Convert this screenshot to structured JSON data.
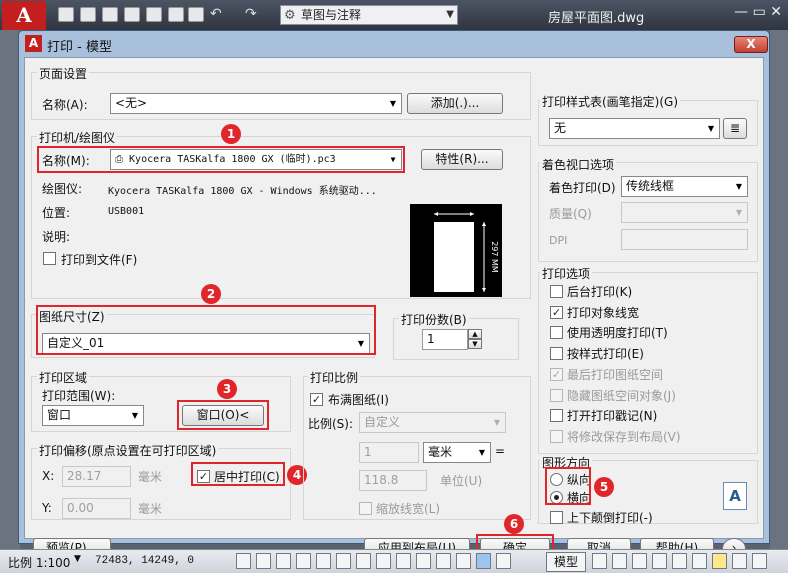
{
  "app": {
    "workspace": "草图与注释",
    "filename": "房屋平面图.dwg",
    "win_controls": "—   ▭   ✕"
  },
  "dialog": {
    "title": "打印 - 模型",
    "close": "X",
    "page_setup": {
      "group": "页面设置",
      "name_label": "名称(A):",
      "name_value": "<无>",
      "add_button": "添加(.)..."
    },
    "printer": {
      "group": "打印机/绘图仪",
      "name_label": "名称(M):",
      "name_value": "Kyocera TASKalfa 1800 GX (临时).pc3",
      "props_button": "特性(R)...",
      "plotter_label": "绘图仪:",
      "plotter_value": "Kyocera TASKalfa 1800 GX - Windows 系统驱动...",
      "location_label": "位置:",
      "location_value": "USB001",
      "desc_label": "说明:",
      "print_to_file": "打印到文件(F)",
      "preview_dim_top": "210 MM",
      "preview_dim_side": "297 MM"
    },
    "paper": {
      "group": "图纸尺寸(Z)",
      "value": "自定义_01"
    },
    "copies": {
      "group": "打印份数(B)",
      "value": "1"
    },
    "area": {
      "group": "打印区域",
      "range_label": "打印范围(W):",
      "range_value": "窗口",
      "window_button": "窗口(O)<"
    },
    "scale": {
      "group": "打印比例",
      "fit": "布满图纸(I)",
      "ratio_label": "比例(S):",
      "ratio_value": "自定义",
      "val1": "1",
      "unit": "毫米",
      "eq": "=",
      "val2": "118.8",
      "unit_label": "单位(U)",
      "scale_lw": "缩放线宽(L)"
    },
    "offset": {
      "group": "打印偏移(原点设置在可打印区域)",
      "x_label": "X:",
      "x_value": "28.17",
      "y_label": "Y:",
      "y_value": "0.00",
      "unit": "毫米",
      "center": "居中打印(C)"
    },
    "style_table": {
      "group": "打印样式表(画笔指定)(G)",
      "value": "无"
    },
    "shaded": {
      "group": "着色视口选项",
      "shade_label": "着色打印(D)",
      "shade_value": "传统线框",
      "quality_label": "质量(Q)",
      "dpi_label": "DPI"
    },
    "options": {
      "group": "打印选项",
      "items": [
        {
          "label": "后台打印(K)",
          "checked": false,
          "enabled": true
        },
        {
          "label": "打印对象线宽",
          "checked": true,
          "enabled": true
        },
        {
          "label": "使用透明度打印(T)",
          "checked": false,
          "enabled": true
        },
        {
          "label": "按样式打印(E)",
          "checked": false,
          "enabled": true
        },
        {
          "label": "最后打印图纸空间",
          "checked": true,
          "enabled": false
        },
        {
          "label": "隐藏图纸空间对象(J)",
          "checked": false,
          "enabled": false
        },
        {
          "label": "打开打印戳记(N)",
          "checked": false,
          "enabled": true
        },
        {
          "label": "将修改保存到布局(V)",
          "checked": false,
          "enabled": false
        }
      ]
    },
    "orientation": {
      "group": "图形方向",
      "portrait": "纵向",
      "landscape": "横向",
      "flip": "上下颠倒打印(-)",
      "icon_letter": "A"
    },
    "buttons": {
      "preview": "预览(P)...",
      "apply_layout": "应用到布局(U)",
      "ok": "确定",
      "cancel": "取消",
      "help": "帮助(H)"
    },
    "markers": [
      "1",
      "2",
      "3",
      "4",
      "5",
      "6"
    ]
  },
  "statusbar": {
    "scale": "比例 1:100",
    "coords": "72483, 14249, 0",
    "model": "模型"
  },
  "colors": {
    "highlight": "#e0262b",
    "accent": "#c41f1f"
  }
}
